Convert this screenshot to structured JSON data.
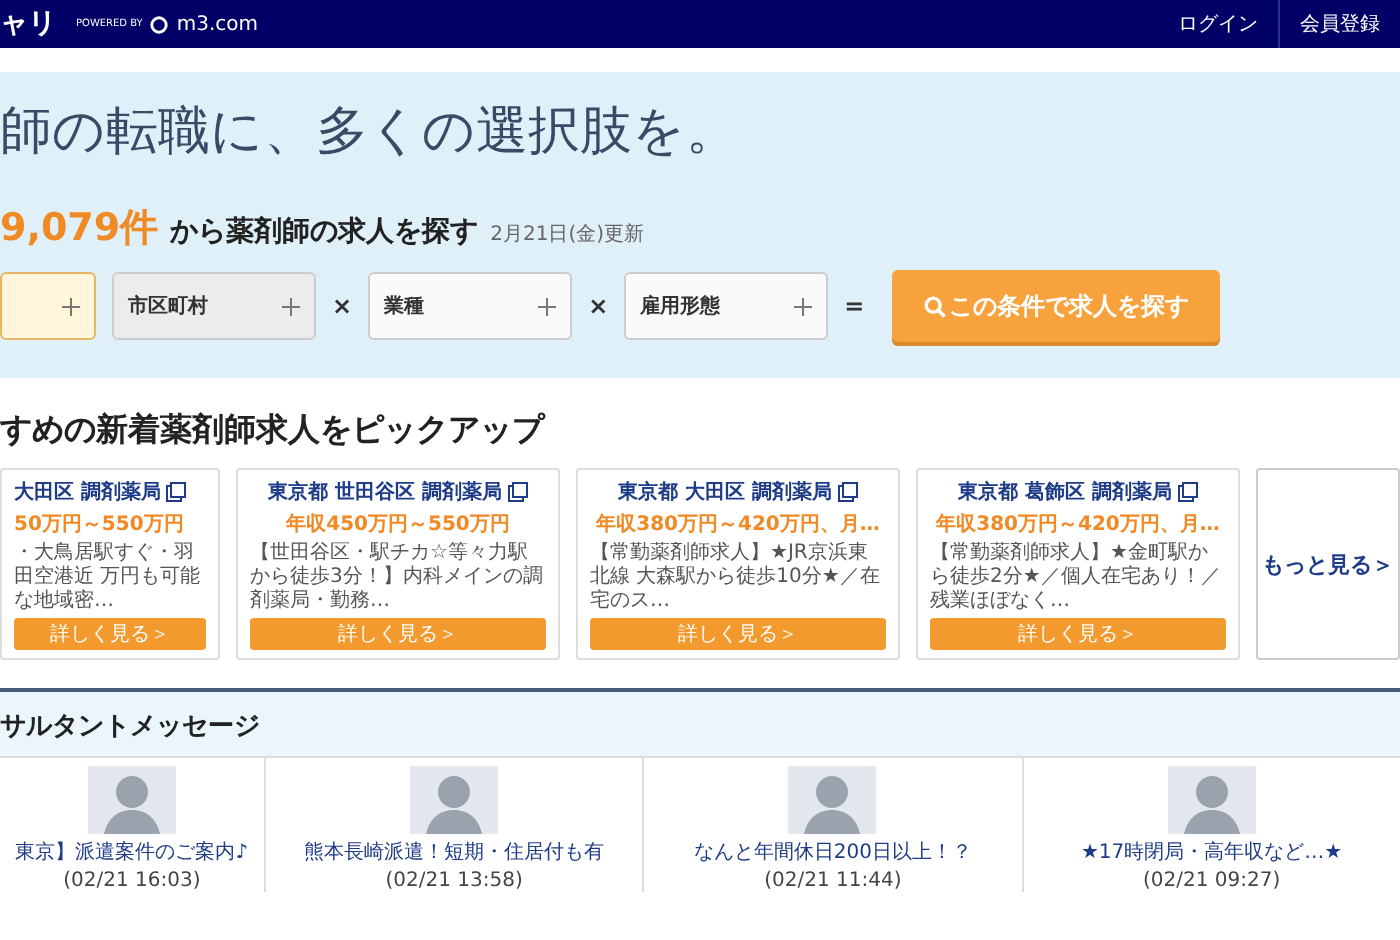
{
  "header": {
    "logo": "ャリ",
    "powered_by": "POWERED BY",
    "brand": "m3.com",
    "nav": [
      "ログイン",
      "会員登録"
    ]
  },
  "hero": {
    "headline": "師の転職に、多くの選択肢を。",
    "count": "9,079件",
    "count_text": "から薬剤師の求人を探す",
    "updated": "2月21日(金)更新",
    "fields": [
      {
        "active": true,
        "disabled": false
      },
      {
        "label": "市区町村",
        "active": false,
        "disabled": true
      },
      {
        "label": "業種",
        "active": false,
        "disabled": false
      },
      {
        "label": "雇用形態",
        "active": false,
        "disabled": false
      }
    ],
    "operators": [
      "×",
      "×",
      "="
    ],
    "search_button": "この条件で求人を探す"
  },
  "pickup": {
    "title": "すめの新着薬剤師求人をピックアップ",
    "cards": [
      {
        "title": "大田区 調剤薬局",
        "salary": "50万円～550万円",
        "description": "・大鳥居駅すぐ・羽田空港近 万円も可能な地域密…",
        "button": "詳しく見る＞"
      },
      {
        "title": "東京都 世田谷区 調剤薬局",
        "salary": "年収450万円～550万円",
        "description": "【世田谷区・駅チカ☆等々力駅から徒歩3分！】内科メインの調剤薬局・勤務…",
        "button": "詳しく見る＞"
      },
      {
        "title": "東京都 大田区 調剤薬局",
        "salary": "年収380万円～420万円、月…",
        "description": "【常勤薬剤師求人】★JR京浜東北線 大森駅から徒歩10分★／在宅のス…",
        "button": "詳しく見る＞"
      },
      {
        "title": "東京都 葛飾区 調剤薬局",
        "salary": "年収380万円～420万円、月…",
        "description": "【常勤薬剤師求人】★金町駅から徒歩2分★／個人在宅あり！／残業ほぼなく…",
        "button": "詳しく見る＞"
      }
    ],
    "more": "もっと見る＞"
  },
  "messages": {
    "title": "サルタントメッセージ",
    "items": [
      {
        "title": "東京】派遣案件のご案内♪",
        "date": "(02/21 16:03)"
      },
      {
        "title": "熊本長崎派遣！短期・住居付も有",
        "date": "(02/21 13:58)"
      },
      {
        "title": "なんと年間休日200日以上！？",
        "date": "(02/21 11:44)"
      },
      {
        "title": "★17時閉局・高年収など…★",
        "date": "(02/21 09:27)"
      }
    ]
  }
}
